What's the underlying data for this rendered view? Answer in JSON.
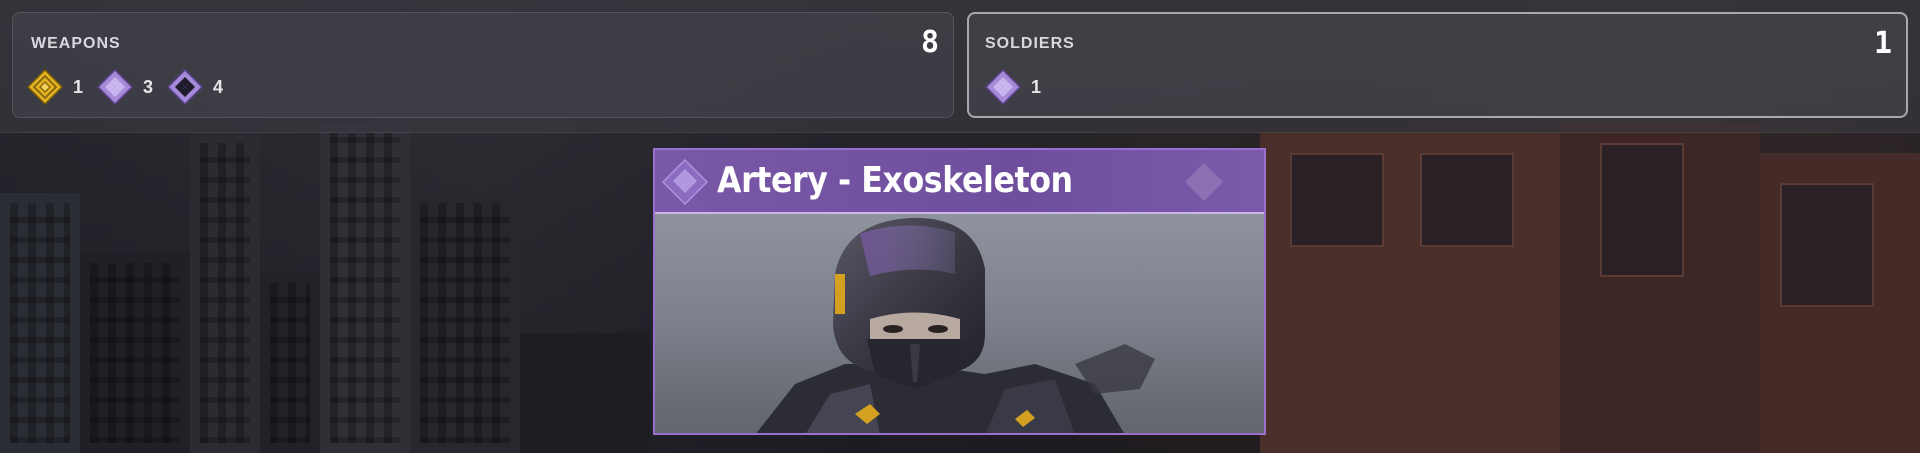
{
  "weapons": {
    "title": "WEAPONS",
    "total": "8",
    "items": [
      {
        "icon": "gold-diamond-icon",
        "color": "#e6b422",
        "count": "1"
      },
      {
        "icon": "purple-diamond-icon",
        "color": "#a58ad8",
        "count": "3"
      },
      {
        "icon": "purple-black-diamond-icon",
        "color": "#a58ad8",
        "count": "4"
      }
    ]
  },
  "soldiers": {
    "title": "SOLDIERS",
    "total": "1",
    "items": [
      {
        "icon": "purple-diamond-icon",
        "color": "#a58ad8",
        "count": "1"
      }
    ]
  },
  "card": {
    "title": "Artery - Exoskeleton",
    "rarity_color": "#7a58a8",
    "border_color": "#9b6fd0"
  }
}
